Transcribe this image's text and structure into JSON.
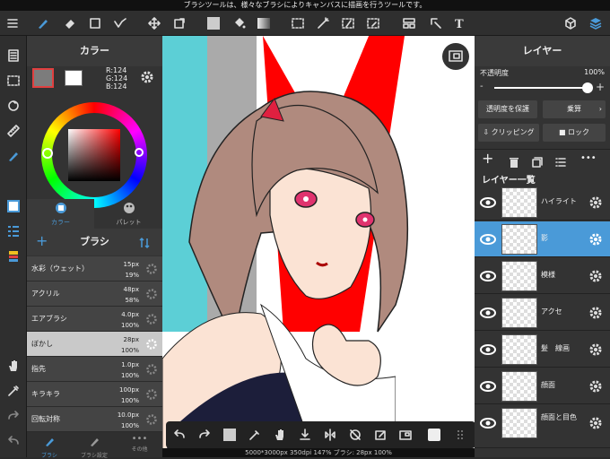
{
  "top_message": "ブラシツールは、様々なブラシによりキャンバスに描画を行うツールです。",
  "color_panel": {
    "title": "カラー",
    "rgb_r": "R:124",
    "rgb_g": "G:124",
    "rgb_b": "B:124",
    "tab_color": "カラー",
    "tab_palette": "パレット"
  },
  "brush_panel": {
    "title": "ブラシ",
    "items": [
      {
        "name": "水彩（ウェット）",
        "size": "15px",
        "opacity": "19%"
      },
      {
        "name": "アクリル",
        "size": "48px",
        "opacity": "58%"
      },
      {
        "name": "エアブラシ",
        "size": "4.0px",
        "opacity": "100%"
      },
      {
        "name": "ぼかし",
        "size": "28px",
        "opacity": "100%"
      },
      {
        "name": "指先",
        "size": "1.0px",
        "opacity": "100%"
      },
      {
        "name": "キラキラ",
        "size": "100px",
        "opacity": "100%"
      },
      {
        "name": "回転対称",
        "size": "10.0px",
        "opacity": "100%"
      }
    ],
    "tab_brush": "ブラシ",
    "tab_settings": "ブラシ設定",
    "tab_other": "その他"
  },
  "layer_panel": {
    "title": "レイヤー",
    "opacity_label": "不透明度",
    "opacity_value": "100%",
    "opacity_fraction": 1.0,
    "protect_btn": "透明度を保護",
    "blend_btn": "乗算",
    "clipping_btn": "クリッピング",
    "lock_btn": "ロック",
    "list_title": "レイヤー一覧",
    "layers": [
      {
        "name": "ハイライト"
      },
      {
        "name": "影"
      },
      {
        "name": "模様"
      },
      {
        "name": "アクセ"
      },
      {
        "name": "髪　線画"
      },
      {
        "name": "顔面"
      },
      {
        "name": "顔面と目色"
      }
    ]
  },
  "status_text": "5000*3000px 350dpi 147% ブラシ: 28px 100%",
  "colors": {
    "accent": "#4a9ad8",
    "current_color": "#7c7c7c",
    "stripe_cyan": "#5ccfd6",
    "stripe_gray": "#aaaaaa",
    "stripe_red": "#ff0000"
  }
}
